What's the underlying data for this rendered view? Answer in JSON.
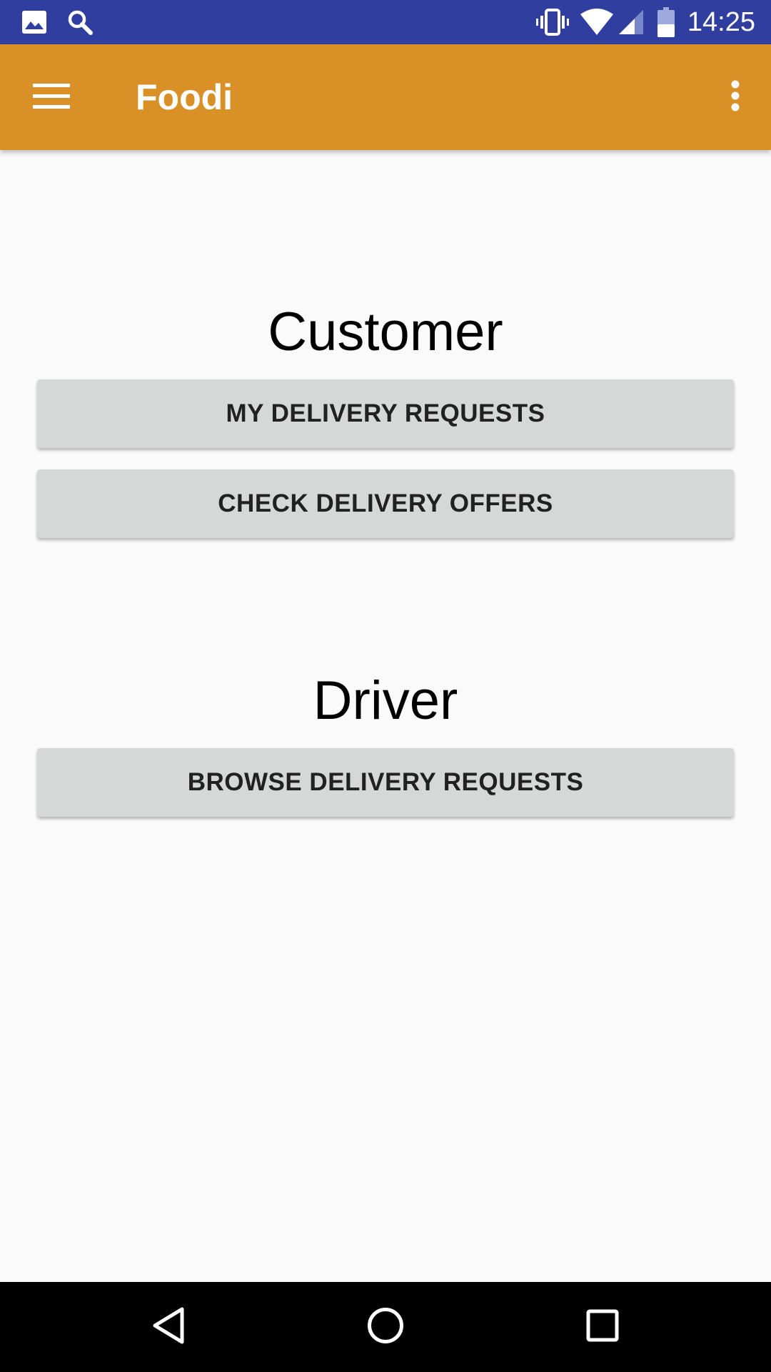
{
  "status_bar": {
    "time": "14:25",
    "left_icons": [
      "image-icon",
      "search-icon"
    ],
    "right_icons": [
      "vibrate-icon",
      "wifi-icon",
      "cell-signal-icon",
      "battery-icon"
    ],
    "background": "#303f9f"
  },
  "app_bar": {
    "title": "Foodi",
    "background": "#d99026",
    "menu_icon": "hamburger-menu-icon",
    "overflow_icon": "more-vert-icon"
  },
  "customer": {
    "heading": "Customer",
    "buttons": [
      {
        "label": "MY DELIVERY REQUESTS"
      },
      {
        "label": "CHECK DELIVERY OFFERS"
      }
    ]
  },
  "driver": {
    "heading": "Driver",
    "buttons": [
      {
        "label": "BROWSE DELIVERY REQUESTS"
      }
    ]
  },
  "nav_bar": {
    "buttons": [
      "back-icon",
      "home-icon",
      "recents-icon"
    ]
  }
}
